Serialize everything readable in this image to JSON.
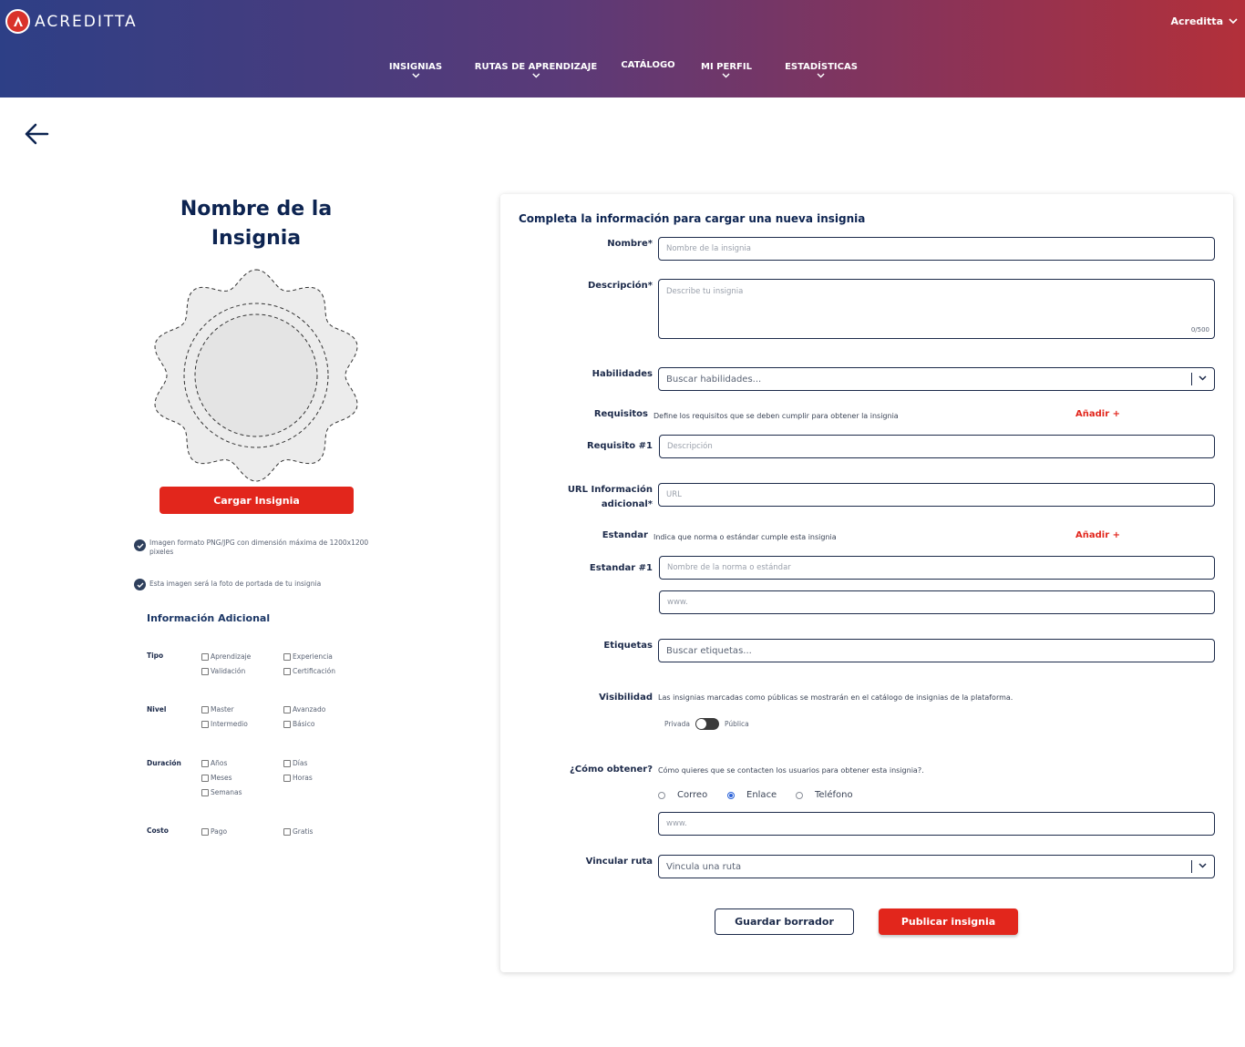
{
  "header": {
    "brand": "ACREDITTA",
    "user": "Acreditta",
    "nav": [
      {
        "label": "INSIGNIAS",
        "has_dropdown": true
      },
      {
        "label": "RUTAS DE APRENDIZAJE",
        "has_dropdown": true
      },
      {
        "label": "CATÁLOGO",
        "has_dropdown": false
      },
      {
        "label": "MI PERFIL",
        "has_dropdown": true
      },
      {
        "label": "ESTADÍSTICAS",
        "has_dropdown": true
      }
    ],
    "gradient": [
      "#2d3f86",
      "#b3303a"
    ]
  },
  "left": {
    "badge_title": "Nombre de la Insignia",
    "upload_button": "Cargar Insignia",
    "notes": [
      "Imagen formato PNG/JPG con dimensión máxima de 1200x1200 pixeles",
      "Esta imagen será la foto de portada de tu insignia"
    ],
    "info_title": "Información Adicional",
    "categories": [
      {
        "label": "Tipo",
        "options": [
          "Aprendizaje",
          "Validación",
          "Experiencia",
          "Certificación"
        ]
      },
      {
        "label": "Nivel",
        "options": [
          "Master",
          "Intermedio",
          "Avanzado",
          "Básico"
        ]
      },
      {
        "label": "Duración",
        "options": [
          "Años",
          "Meses",
          "Semanas",
          "Días",
          "Horas"
        ]
      },
      {
        "label": "Costo",
        "options": [
          "Pago",
          "Gratis"
        ]
      }
    ]
  },
  "form": {
    "title": "Completa la información para cargar una nueva insignia",
    "nombre": {
      "label": "Nombre*",
      "placeholder": "Nombre de la insignia"
    },
    "descripcion": {
      "label": "Descripción*",
      "placeholder": "Describe tu insignia",
      "counter": "0/500"
    },
    "habilidades": {
      "label": "Habilidades",
      "placeholder": "Buscar habilidades..."
    },
    "requisitos": {
      "label": "Requisitos",
      "hint": "Define los requisitos que se deben cumplir para obtener la insignia",
      "add": "Añadir +",
      "item_label": "Requisito #1",
      "item_placeholder": "Descripción"
    },
    "url": {
      "label_line1": "URL Información",
      "label_line2": "adicional*",
      "placeholder": "URL"
    },
    "estandar": {
      "label": "Estandar",
      "hint": "Indica que norma o estándar cumple esta insignia",
      "add": "Añadir +",
      "item_label": "Estandar #1",
      "item_placeholder": "Nombre de la norma  o estándar",
      "url_placeholder": "www."
    },
    "etiquetas": {
      "label": "Etiquetas",
      "placeholder": "Buscar etiquetas..."
    },
    "visibilidad": {
      "label": "Visibilidad",
      "hint": "Las insignias marcadas como públicas se mostrarán en el catálogo de insignias de la plataforma.",
      "off_label": "Privada",
      "on_label": "Pública"
    },
    "obtener": {
      "label": "¿Cómo obtener?",
      "hint": "Cómo quieres que se contacten los usuarios para obtener esta insignia?.",
      "options": [
        "Correo",
        "Enlace",
        "Teléfono"
      ],
      "selected": "Enlace",
      "placeholder": "www."
    },
    "ruta": {
      "label": "Vincular ruta",
      "placeholder": "Vincula una ruta"
    },
    "save_button": "Guardar borrador",
    "publish_button": "Publicar insignia"
  },
  "colors": {
    "primary_red": "#e2261c",
    "navy": "#0d2451"
  }
}
